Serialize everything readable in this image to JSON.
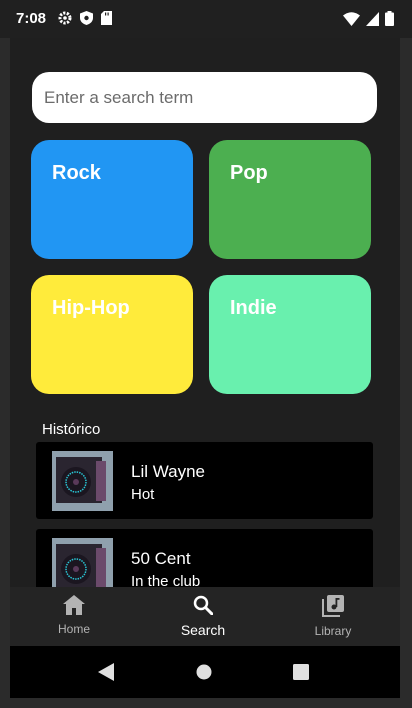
{
  "status": {
    "time": "7:08",
    "left_icons": [
      "settings-icon",
      "shield-icon",
      "sd-card-icon"
    ],
    "right_icons": [
      "wifi-icon",
      "signal-icon",
      "battery-icon"
    ]
  },
  "search": {
    "placeholder": "Enter a search term",
    "value": ""
  },
  "genres": [
    {
      "label": "Rock",
      "color": "#2196F3"
    },
    {
      "label": "Pop",
      "color": "#4CAF50"
    },
    {
      "label": "Hip-Hop",
      "color": "#FFEB3B"
    },
    {
      "label": "Indie",
      "color": "#69F0AE"
    }
  ],
  "history": {
    "title": "Histórico",
    "items": [
      {
        "artist": "Lil Wayne",
        "title": "Hot"
      },
      {
        "artist": "50 Cent",
        "title": "In the club"
      }
    ]
  },
  "bottom_nav": {
    "items": [
      {
        "label": "Home",
        "icon": "home-icon",
        "active": false
      },
      {
        "label": "Search",
        "icon": "search-icon",
        "active": true
      },
      {
        "label": "Library",
        "icon": "library-icon",
        "active": false
      }
    ]
  },
  "system_nav": [
    "back-icon",
    "home-circle-icon",
    "recents-icon"
  ]
}
